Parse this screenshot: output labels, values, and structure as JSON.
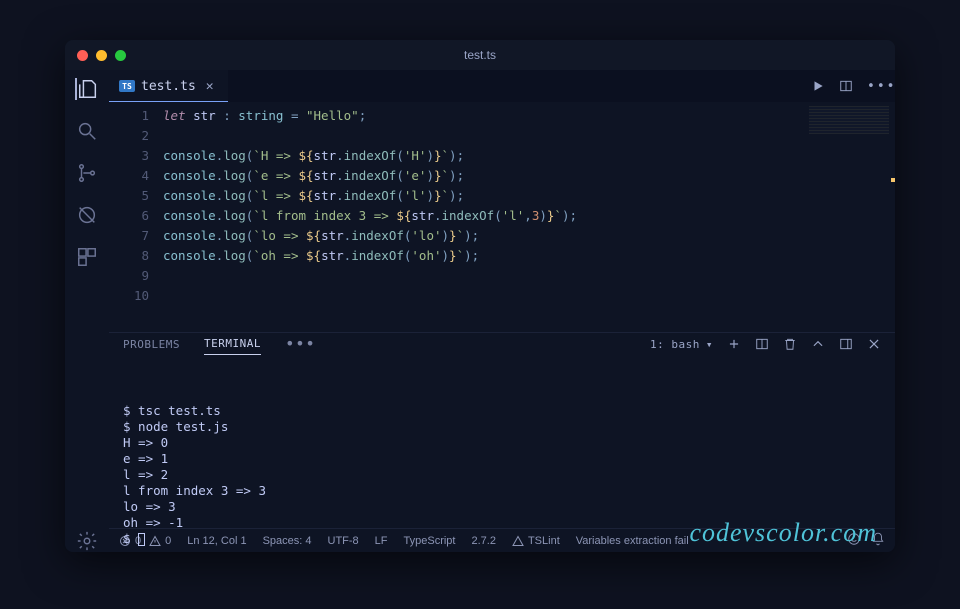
{
  "title": "test.ts",
  "tab": {
    "icon_label": "TS",
    "name": "test.ts"
  },
  "code_lines": [
    {
      "n": 1,
      "tokens": [
        {
          "t": "let",
          "c": "kw"
        },
        {
          "t": " "
        },
        {
          "t": "str",
          "c": "ident"
        },
        {
          "t": " : ",
          "c": "punc"
        },
        {
          "t": "string",
          "c": "type"
        },
        {
          "t": " = ",
          "c": "op"
        },
        {
          "t": "\"Hello\"",
          "c": "str"
        },
        {
          "t": ";",
          "c": "punc"
        }
      ]
    },
    {
      "n": 2,
      "tokens": []
    },
    {
      "n": 3,
      "tokens": [
        {
          "t": "console",
          "c": "obj"
        },
        {
          "t": ".",
          "c": "punc"
        },
        {
          "t": "log",
          "c": "fn"
        },
        {
          "t": "(",
          "c": "punc"
        },
        {
          "t": "`H => ",
          "c": "tpl"
        },
        {
          "t": "${",
          "c": "interp"
        },
        {
          "t": "str",
          "c": "ident"
        },
        {
          "t": ".",
          "c": "punc"
        },
        {
          "t": "indexOf",
          "c": "fn"
        },
        {
          "t": "(",
          "c": "punc"
        },
        {
          "t": "'H'",
          "c": "str"
        },
        {
          "t": ")",
          "c": "punc"
        },
        {
          "t": "}",
          "c": "interp"
        },
        {
          "t": "`",
          "c": "tpl"
        },
        {
          "t": ")",
          "c": "punc"
        },
        {
          "t": ";",
          "c": "punc"
        }
      ]
    },
    {
      "n": 4,
      "tokens": [
        {
          "t": "console",
          "c": "obj"
        },
        {
          "t": ".",
          "c": "punc"
        },
        {
          "t": "log",
          "c": "fn"
        },
        {
          "t": "(",
          "c": "punc"
        },
        {
          "t": "`e => ",
          "c": "tpl"
        },
        {
          "t": "${",
          "c": "interp"
        },
        {
          "t": "str",
          "c": "ident"
        },
        {
          "t": ".",
          "c": "punc"
        },
        {
          "t": "indexOf",
          "c": "fn"
        },
        {
          "t": "(",
          "c": "punc"
        },
        {
          "t": "'e'",
          "c": "str"
        },
        {
          "t": ")",
          "c": "punc"
        },
        {
          "t": "}",
          "c": "interp"
        },
        {
          "t": "`",
          "c": "tpl"
        },
        {
          "t": ")",
          "c": "punc"
        },
        {
          "t": ";",
          "c": "punc"
        }
      ]
    },
    {
      "n": 5,
      "tokens": [
        {
          "t": "console",
          "c": "obj"
        },
        {
          "t": ".",
          "c": "punc"
        },
        {
          "t": "log",
          "c": "fn"
        },
        {
          "t": "(",
          "c": "punc"
        },
        {
          "t": "`l => ",
          "c": "tpl"
        },
        {
          "t": "${",
          "c": "interp"
        },
        {
          "t": "str",
          "c": "ident"
        },
        {
          "t": ".",
          "c": "punc"
        },
        {
          "t": "indexOf",
          "c": "fn"
        },
        {
          "t": "(",
          "c": "punc"
        },
        {
          "t": "'l'",
          "c": "str"
        },
        {
          "t": ")",
          "c": "punc"
        },
        {
          "t": "}",
          "c": "interp"
        },
        {
          "t": "`",
          "c": "tpl"
        },
        {
          "t": ")",
          "c": "punc"
        },
        {
          "t": ";",
          "c": "punc"
        }
      ]
    },
    {
      "n": 6,
      "tokens": [
        {
          "t": "console",
          "c": "obj"
        },
        {
          "t": ".",
          "c": "punc"
        },
        {
          "t": "log",
          "c": "fn"
        },
        {
          "t": "(",
          "c": "punc"
        },
        {
          "t": "`l from index 3 => ",
          "c": "tpl"
        },
        {
          "t": "${",
          "c": "interp"
        },
        {
          "t": "str",
          "c": "ident"
        },
        {
          "t": ".",
          "c": "punc"
        },
        {
          "t": "indexOf",
          "c": "fn"
        },
        {
          "t": "(",
          "c": "punc"
        },
        {
          "t": "'l'",
          "c": "str"
        },
        {
          "t": ",",
          "c": "punc"
        },
        {
          "t": "3",
          "c": "num"
        },
        {
          "t": ")",
          "c": "punc"
        },
        {
          "t": "}",
          "c": "interp"
        },
        {
          "t": "`",
          "c": "tpl"
        },
        {
          "t": ")",
          "c": "punc"
        },
        {
          "t": ";",
          "c": "punc"
        }
      ]
    },
    {
      "n": 7,
      "tokens": [
        {
          "t": "console",
          "c": "obj"
        },
        {
          "t": ".",
          "c": "punc"
        },
        {
          "t": "log",
          "c": "fn"
        },
        {
          "t": "(",
          "c": "punc"
        },
        {
          "t": "`lo => ",
          "c": "tpl"
        },
        {
          "t": "${",
          "c": "interp"
        },
        {
          "t": "str",
          "c": "ident"
        },
        {
          "t": ".",
          "c": "punc"
        },
        {
          "t": "indexOf",
          "c": "fn"
        },
        {
          "t": "(",
          "c": "punc"
        },
        {
          "t": "'lo'",
          "c": "str"
        },
        {
          "t": ")",
          "c": "punc"
        },
        {
          "t": "}",
          "c": "interp"
        },
        {
          "t": "`",
          "c": "tpl"
        },
        {
          "t": ")",
          "c": "punc"
        },
        {
          "t": ";",
          "c": "punc"
        }
      ]
    },
    {
      "n": 8,
      "tokens": [
        {
          "t": "console",
          "c": "obj"
        },
        {
          "t": ".",
          "c": "punc"
        },
        {
          "t": "log",
          "c": "fn"
        },
        {
          "t": "(",
          "c": "punc"
        },
        {
          "t": "`oh => ",
          "c": "tpl"
        },
        {
          "t": "${",
          "c": "interp"
        },
        {
          "t": "str",
          "c": "ident"
        },
        {
          "t": ".",
          "c": "punc"
        },
        {
          "t": "indexOf",
          "c": "fn"
        },
        {
          "t": "(",
          "c": "punc"
        },
        {
          "t": "'oh'",
          "c": "str"
        },
        {
          "t": ")",
          "c": "punc"
        },
        {
          "t": "}",
          "c": "interp"
        },
        {
          "t": "`",
          "c": "tpl"
        },
        {
          "t": ")",
          "c": "punc"
        },
        {
          "t": ";",
          "c": "punc"
        }
      ]
    },
    {
      "n": 9,
      "tokens": []
    },
    {
      "n": 10,
      "tokens": []
    }
  ],
  "panel": {
    "tabs": {
      "problems": "PROBLEMS",
      "terminal": "TERMINAL"
    },
    "select": "1: bash",
    "output_lines": [
      "$ tsc test.ts",
      "$ node test.js",
      "H => 0",
      "e => 1",
      "l => 2",
      "l from index 3 => 3",
      "lo => 3",
      "oh => -1",
      "$ "
    ],
    "watermark": "codevscolor.com"
  },
  "status": {
    "errors": "0",
    "warnings": "0",
    "position": "Ln 12, Col 1",
    "spaces": "Spaces: 4",
    "encoding": "UTF-8",
    "eol": "LF",
    "language": "TypeScript",
    "version": "2.7.2",
    "lint": "TSLint",
    "extra": "Variables extraction fail"
  }
}
